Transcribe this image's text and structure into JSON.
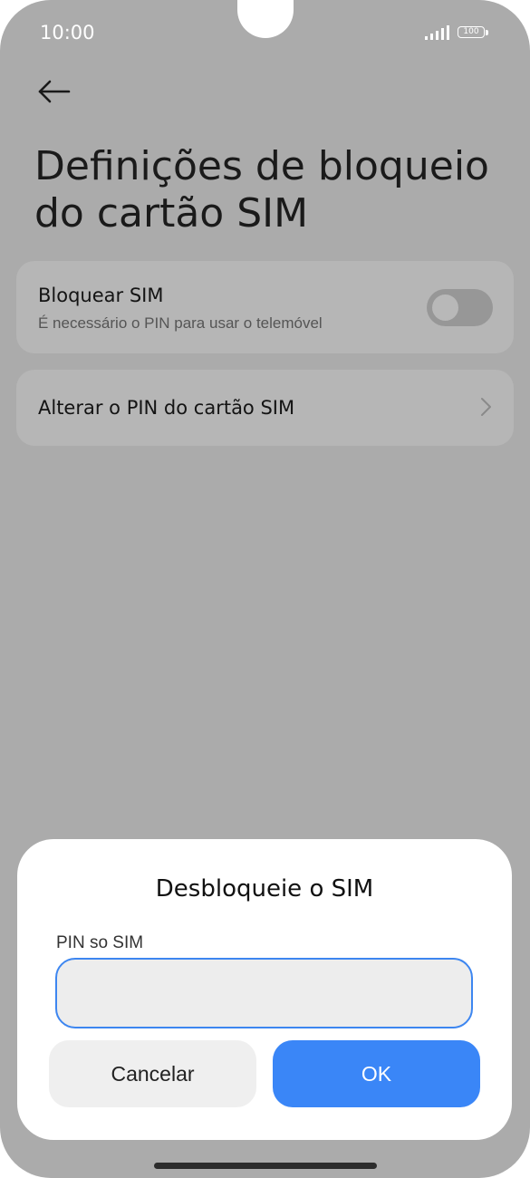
{
  "status_bar": {
    "time": "10:00",
    "battery": "100",
    "signal_icon": "signal-bars-icon",
    "battery_icon": "battery-icon"
  },
  "header": {
    "back_icon": "arrow-left-icon",
    "title": "Definições de bloqueio do cartão SIM"
  },
  "settings": {
    "lock_sim": {
      "title": "Bloquear SIM",
      "subtitle": "É necessário o PIN para usar o telemóvel",
      "enabled": false
    },
    "change_pin": {
      "title": "Alterar o PIN do cartão SIM",
      "chevron_icon": "chevron-right-icon"
    }
  },
  "dialog": {
    "title": "Desbloqueie o SIM",
    "field_label": "PIN so SIM",
    "field_value": "",
    "cancel_label": "Cancelar",
    "ok_label": "OK"
  },
  "colors": {
    "accent": "#3a86f7",
    "overlay": "#ababab"
  }
}
